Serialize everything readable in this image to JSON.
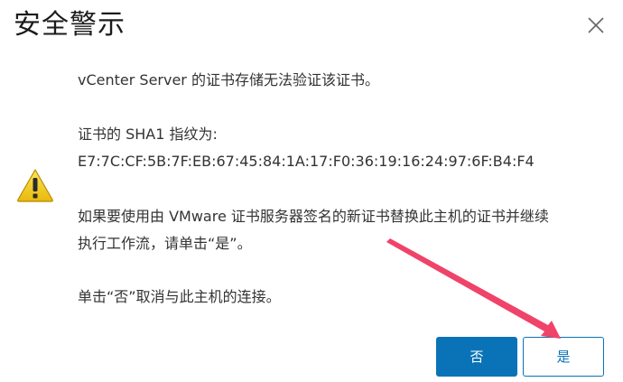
{
  "dialog": {
    "title": "安全警示",
    "close_icon": "close-icon",
    "warning_icon": "warning-icon",
    "messages": [
      "vCenter Server 的证书存储无法验证该证书。",
      "证书的 SHA1 指纹为:",
      "E7:7C:CF:5B:7F:EB:67:45:84:1A:17:F0:36:19:16:24:97:6F:B4:F4",
      "如果要使用由 VMware 证书服务器签名的新证书替换此主机的证书并继续",
      "执行工作流，请单击“是”。",
      "单击“否”取消与此主机的连接。"
    ]
  },
  "buttons": {
    "no_label": "否",
    "yes_label": "是"
  },
  "colors": {
    "primary": "#0a73b7",
    "warning_fill": "#f5d31c",
    "arrow": "#f0436a"
  }
}
